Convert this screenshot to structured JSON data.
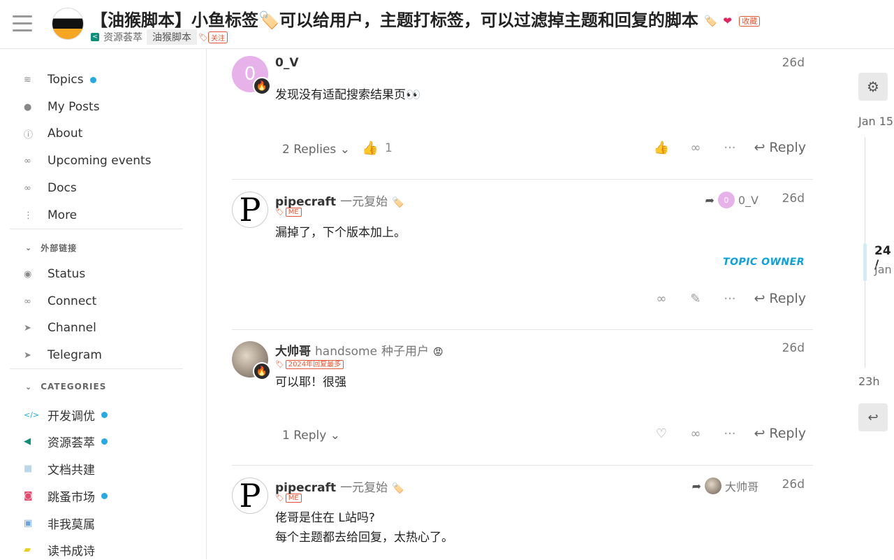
{
  "header": {
    "title": "【油猴脚本】小鱼标签🏷️可以给用户，主题打标签，可以过滤掉主题和回复的脚本",
    "title_tag": "收藏",
    "category": "资源荟萃",
    "tag": "油猴脚本",
    "follow_tag": "关注"
  },
  "sidebar": {
    "items": [
      {
        "label": "Topics",
        "icon": "layers-icon"
      },
      {
        "label": "My Posts",
        "icon": "user-icon"
      },
      {
        "label": "About",
        "icon": "info-icon"
      },
      {
        "label": "Upcoming events",
        "icon": "link-icon"
      },
      {
        "label": "Docs",
        "icon": "link-icon"
      },
      {
        "label": "More",
        "icon": "vertical-dots-icon"
      }
    ],
    "external_header": "外部链接",
    "external": [
      {
        "label": "Status",
        "icon": "eye-icon"
      },
      {
        "label": "Connect",
        "icon": "link-icon"
      },
      {
        "label": "Channel",
        "icon": "paper-plane-icon"
      },
      {
        "label": "Telegram",
        "icon": "paper-plane-icon"
      }
    ],
    "categories_header": "CATEGORIES",
    "categories": [
      {
        "label": "开发调优",
        "color": "#25aae1"
      },
      {
        "label": "资源荟萃",
        "color": "#0e8f7a"
      },
      {
        "label": "文档共建",
        "color": "#bcd7e8"
      },
      {
        "label": "跳蚤市场",
        "color": "#e84a6f"
      },
      {
        "label": "非我莫属",
        "color": "#6aa5e0"
      },
      {
        "label": "读书成诗",
        "color": "#f7e23b"
      }
    ]
  },
  "posts": [
    {
      "avatar_letter": "0",
      "username": "0_V",
      "date": "26d",
      "body": "发现没有适配搜索结果页👀",
      "replies": "2 Replies",
      "likes": "1",
      "reply_label": "Reply"
    },
    {
      "username": "pipecraft",
      "title": "一元复始",
      "user_tag": "ME",
      "reply_to": "0_V",
      "reply_to_letter": "0",
      "date": "26d",
      "body": "漏掉了，下个版本加上。",
      "badge": "TOPIC OWNER",
      "reply_label": "Reply"
    },
    {
      "username": "大帅哥",
      "name": "handsome",
      "title": "种子用户",
      "user_tag": "2024年回复最多",
      "date": "26d",
      "body": "可以耶！很强",
      "replies": "1 Reply",
      "reply_label": "Reply"
    },
    {
      "username": "pipecraft",
      "title": "一元复始",
      "user_tag": "ME",
      "reply_to": "大帅哥",
      "date": "26d",
      "body_line1": "佬哥是住在 L站吗?",
      "body_line2": "每个主题都去给回复，太热心了。"
    }
  ],
  "timeline": {
    "start": "Jan 15",
    "position": "24 /",
    "position_date": "Jan",
    "end": "23h"
  }
}
